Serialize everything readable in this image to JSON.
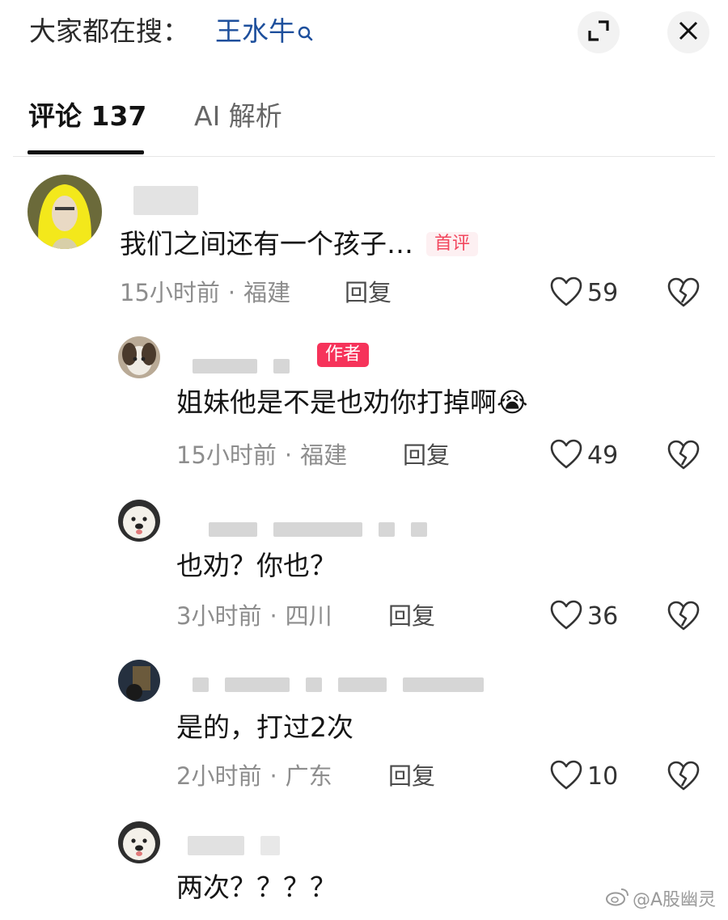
{
  "header": {
    "search_prefix": "大家都在搜：",
    "search_term": "王水牛"
  },
  "tabs": [
    {
      "label": "评论 137"
    },
    {
      "label": "AI 解析"
    }
  ],
  "comments": [
    {
      "text": "我们之间还有一个孩子…",
      "badge": "首评",
      "time": "15小时前",
      "location": "福建",
      "reply": "回复",
      "likes": "59"
    },
    {
      "badge": "作者",
      "text": "姐妹他是不是也劝你打掉啊😭",
      "time": "15小时前",
      "location": "福建",
      "reply": "回复",
      "likes": "49"
    },
    {
      "text": "也劝？你也？",
      "time": "3小时前",
      "location": "四川",
      "reply": "回复",
      "likes": "36"
    },
    {
      "text": "是的，打过2次",
      "time": "2小时前",
      "location": "广东",
      "reply": "回复",
      "likes": "10"
    },
    {
      "text": "两次？？？？"
    }
  ],
  "meta_separator": "·",
  "watermark": "@A股幽灵",
  "colors": {
    "search_term": "#1d4f9c",
    "badge_first_text": "#f2475e",
    "badge_author_bg": "#f6335a",
    "meta_text": "#8d8d8d"
  },
  "icons": [
    "magnifier-icon",
    "expand-icon",
    "close-icon",
    "heart-icon",
    "broken-heart-icon",
    "weibo-icon"
  ]
}
